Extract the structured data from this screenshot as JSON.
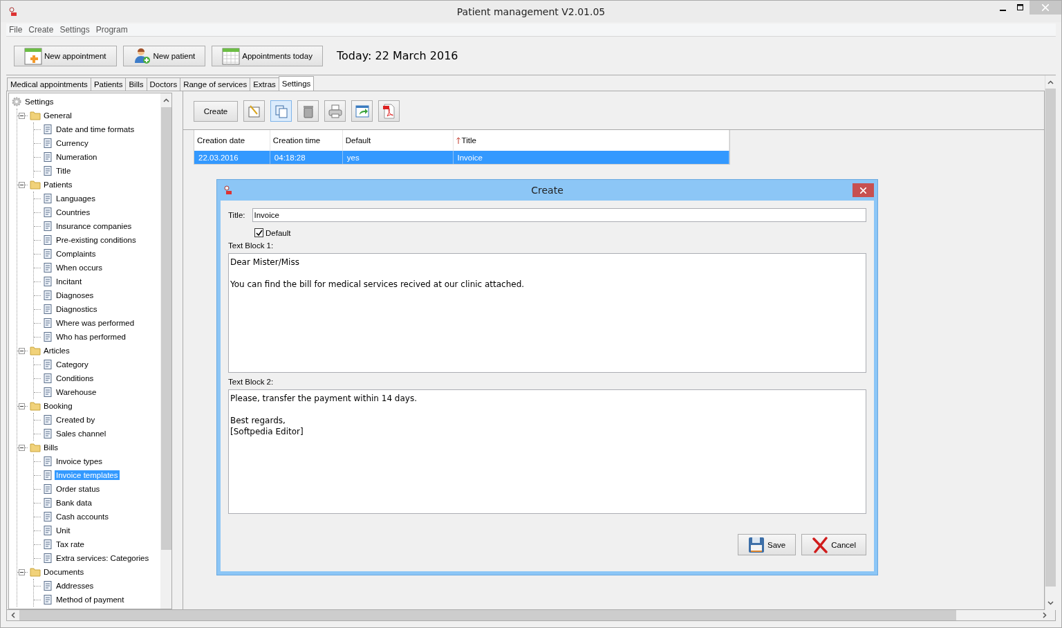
{
  "window": {
    "title": "Patient management V2.01.05"
  },
  "menu": [
    "File",
    "Create",
    "Settings",
    "Program"
  ],
  "toolbar": {
    "buttons": [
      {
        "kind": "appointment",
        "label": "New appointment"
      },
      {
        "kind": "patient",
        "label": "New patient"
      },
      {
        "kind": "calendar",
        "label": "Appointments today"
      }
    ],
    "today": "Today: 22 March 2016"
  },
  "tabs": [
    {
      "label": "Medical appointments",
      "selected": false
    },
    {
      "label": "Patients",
      "selected": false
    },
    {
      "label": "Bills",
      "selected": false
    },
    {
      "label": "Doctors",
      "selected": false
    },
    {
      "label": "Range of services",
      "selected": false
    },
    {
      "label": "Extras",
      "selected": false
    },
    {
      "label": "Settings",
      "selected": true
    }
  ],
  "tree": {
    "label": "Settings",
    "selected": false,
    "children": [
      {
        "label": "General",
        "expanded": true,
        "selected": false,
        "children": [
          {
            "label": "Date and time formats",
            "selected": false
          },
          {
            "label": "Currency",
            "selected": false
          },
          {
            "label": "Numeration",
            "selected": false
          },
          {
            "label": "Title",
            "selected": false
          }
        ]
      },
      {
        "label": "Patients",
        "expanded": true,
        "selected": false,
        "children": [
          {
            "label": "Languages",
            "selected": false
          },
          {
            "label": "Countries",
            "selected": false
          },
          {
            "label": "Insurance companies",
            "selected": false
          },
          {
            "label": "Pre-existing conditions",
            "selected": false
          },
          {
            "label": "Complaints",
            "selected": false
          },
          {
            "label": "When occurs",
            "selected": false
          },
          {
            "label": "Incitant",
            "selected": false
          },
          {
            "label": "Diagnoses",
            "selected": false
          },
          {
            "label": "Diagnostics",
            "selected": false
          },
          {
            "label": "Where was performed",
            "selected": false
          },
          {
            "label": "Who has performed",
            "selected": false
          }
        ]
      },
      {
        "label": "Articles",
        "expanded": true,
        "selected": false,
        "children": [
          {
            "label": "Category",
            "selected": false
          },
          {
            "label": "Conditions",
            "selected": false
          },
          {
            "label": "Warehouse",
            "selected": false
          }
        ]
      },
      {
        "label": "Booking",
        "expanded": true,
        "selected": false,
        "children": [
          {
            "label": "Created by",
            "selected": false
          },
          {
            "label": "Sales channel",
            "selected": false
          }
        ]
      },
      {
        "label": "Bills",
        "expanded": true,
        "selected": false,
        "children": [
          {
            "label": "Invoice types",
            "selected": false
          },
          {
            "label": "Invoice templates",
            "selected": true
          },
          {
            "label": "Order status",
            "selected": false
          },
          {
            "label": "Bank data",
            "selected": false
          },
          {
            "label": "Cash accounts",
            "selected": false
          },
          {
            "label": "Unit",
            "selected": false
          },
          {
            "label": "Tax rate",
            "selected": false
          },
          {
            "label": "Extra services: Categories",
            "selected": false
          }
        ]
      },
      {
        "label": "Documents",
        "expanded": true,
        "selected": false,
        "children": [
          {
            "label": "Addresses",
            "selected": false
          },
          {
            "label": "Method of payment",
            "selected": false
          }
        ]
      }
    ]
  },
  "actions": {
    "create": "Create",
    "tools": [
      {
        "kind": "edit",
        "active": false
      },
      {
        "kind": "copy",
        "active": true
      },
      {
        "kind": "delete",
        "active": false
      },
      {
        "kind": "print",
        "active": false
      },
      {
        "kind": "export",
        "active": false
      },
      {
        "kind": "pdf",
        "active": false
      }
    ]
  },
  "table": {
    "columns": [
      {
        "label": "Creation date",
        "sorted": false
      },
      {
        "label": "Creation time",
        "sorted": false
      },
      {
        "label": "Default",
        "sorted": false
      },
      {
        "label": "Title",
        "sorted": true
      }
    ],
    "rows": [
      {
        "selected": true,
        "cells": [
          "22.03.2016",
          "04:18:28",
          "yes",
          "Invoice"
        ]
      }
    ]
  },
  "dialog": {
    "title": "Create",
    "title_label": "Title:",
    "title_value": "Invoice",
    "default": {
      "label": "Default",
      "checked": true
    },
    "block1": {
      "label": "Text Block 1:",
      "value": "Dear Mister/Miss\n\nYou can find the bill for medical services recived at our clinic attached."
    },
    "block2": {
      "label": "Text Block 2:",
      "value": "Please, transfer the payment within 14 days.\n\nBest regards,\n[Softpedia Editor]"
    },
    "buttons": [
      {
        "kind": "save",
        "label": "Save"
      },
      {
        "kind": "cancel",
        "label": "Cancel"
      }
    ]
  }
}
